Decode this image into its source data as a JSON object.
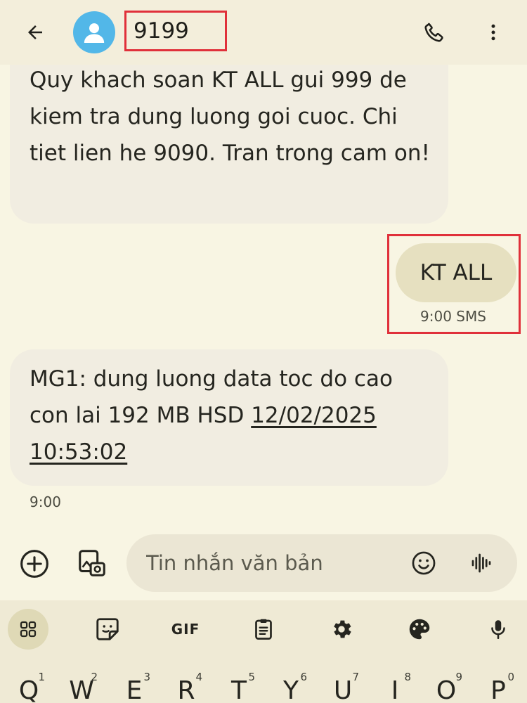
{
  "header": {
    "contact": "9199",
    "back_icon": "arrow-left-icon",
    "call_icon": "phone-icon",
    "more_icon": "more-vert-icon"
  },
  "messages": [
    {
      "direction": "incoming",
      "text": "Quy khach soan KT ALL gui 999 de kiem tra dung luong goi cuoc. Chi tiet lien he 9090. Tran trong cam on!"
    },
    {
      "direction": "outgoing",
      "text": "KT ALL",
      "meta": "9:00 SMS"
    },
    {
      "direction": "incoming",
      "text": "MG1: dung luong data toc do cao con lai 192 MB HSD ",
      "link": "12/02/2025 10:53:02",
      "meta": "9:00"
    }
  ],
  "compose": {
    "placeholder": "Tin nhắn văn bản"
  },
  "keyboard": {
    "toolbar": [
      "apps-grid-icon",
      "sticker-icon",
      "GIF",
      "clipboard-icon",
      "settings-icon",
      "palette-icon",
      "mic-icon"
    ],
    "gif_label": "GIF",
    "keys": [
      {
        "label": "Q",
        "sup": "1"
      },
      {
        "label": "W",
        "sup": "2"
      },
      {
        "label": "E",
        "sup": "3"
      },
      {
        "label": "R",
        "sup": "4"
      },
      {
        "label": "T",
        "sup": "5"
      },
      {
        "label": "Y",
        "sup": "6"
      },
      {
        "label": "U",
        "sup": "7"
      },
      {
        "label": "I",
        "sup": "8"
      },
      {
        "label": "O",
        "sup": "9"
      },
      {
        "label": "P",
        "sup": "0"
      }
    ]
  },
  "colors": {
    "background": "#f8f5e3",
    "avatar": "#52b7e8",
    "highlight_box": "#e0303a",
    "sent_bubble": "#e6e0c0",
    "received_bubble": "#f1ede1"
  }
}
